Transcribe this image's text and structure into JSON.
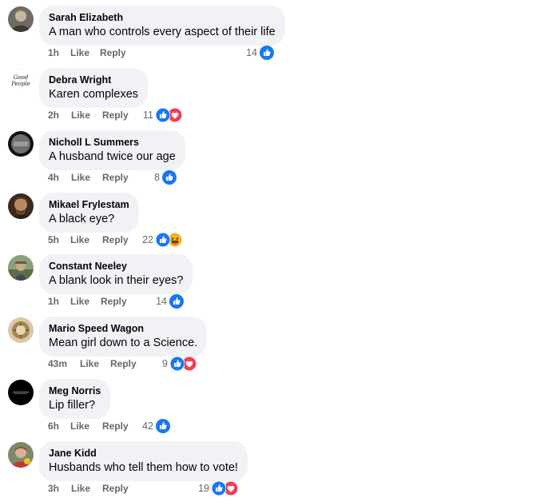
{
  "comments": [
    {
      "author": "Sarah Elizabeth",
      "text": "A man who controls every aspect of their life",
      "time": "1h",
      "like": "Like",
      "reply": "Reply",
      "count": "14",
      "reactions": [
        "like-icon"
      ]
    },
    {
      "author": "Debra Wright",
      "text": "Karen complexes",
      "time": "2h",
      "like": "Like",
      "reply": "Reply",
      "count": "11",
      "reactions": [
        "like-icon",
        "love-icon"
      ]
    },
    {
      "author": "Nicholl L Summers",
      "text": "A husband twice our age",
      "time": "4h",
      "like": "Like",
      "reply": "Reply",
      "count": "8",
      "reactions": [
        "like-icon"
      ]
    },
    {
      "author": "Mikael Frylestam",
      "text": "A black eye?",
      "time": "5h",
      "like": "Like",
      "reply": "Reply",
      "count": "22",
      "reactions": [
        "like-icon",
        "haha-icon"
      ]
    },
    {
      "author": "Constant Neeley",
      "text": "A blank look in their eyes?",
      "time": "1h",
      "like": "Like",
      "reply": "Reply",
      "count": "14",
      "reactions": [
        "like-icon"
      ]
    },
    {
      "author": "Mario Speed Wagon",
      "text": "Mean girl down to a Science.",
      "time": "43m",
      "like": "Like",
      "reply": "Reply",
      "count": "9",
      "reactions": [
        "like-icon",
        "love-icon"
      ]
    },
    {
      "author": "Meg Norris",
      "text": "Lip filler?",
      "time": "6h",
      "like": "Like",
      "reply": "Reply",
      "count": "42",
      "reactions": [
        "like-icon"
      ]
    },
    {
      "author": "Jane Kidd",
      "text": "Husbands who tell them how to vote!",
      "time": "3h",
      "like": "Like",
      "reply": "Reply",
      "count": "19",
      "reactions": [
        "like-icon",
        "love-icon"
      ]
    }
  ],
  "avatar_text": {
    "debra": "Good People"
  },
  "colors": {
    "like": "#1877f2",
    "love": "#f33e58",
    "haha": "#f7b125",
    "bubble": "#f0f2f5",
    "meta": "#65676b"
  }
}
